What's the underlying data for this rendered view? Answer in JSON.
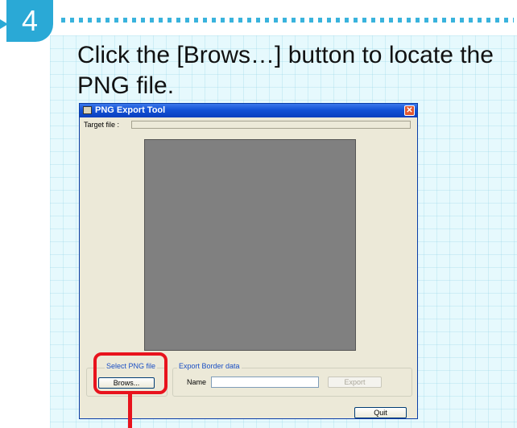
{
  "step": {
    "number": "4",
    "instruction": "Click the [Brows…] button to locate the PNG file."
  },
  "window": {
    "title": "PNG Export Tool",
    "close_glyph": "✕",
    "target_file_label": "Target file :",
    "target_file_value": "",
    "select_group_title": "Select PNG file",
    "browse_button_label": "Brows...",
    "export_group_title": "Export Border data",
    "name_label": "Name",
    "name_value": "",
    "export_button_label": "Export",
    "quit_button_label": "Quit"
  },
  "colors": {
    "accent_blue": "#2aa9d6",
    "highlight_red": "#e8131d",
    "panel_bg": "#e6f9fd"
  }
}
